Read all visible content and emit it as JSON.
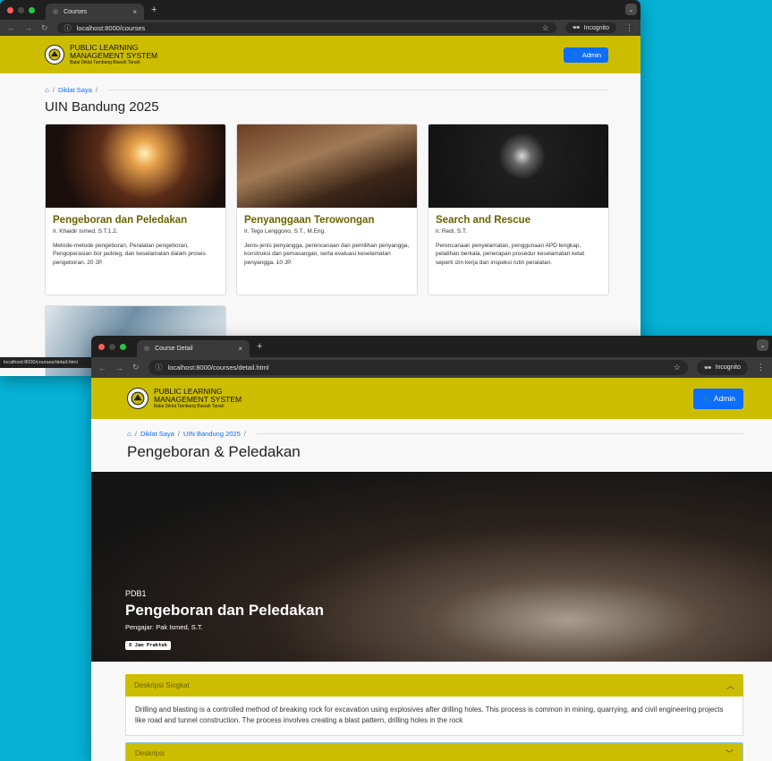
{
  "windows": {
    "courses": {
      "tab_title": "Courses",
      "url": "localhost:8000/courses",
      "incognito": "Incognito",
      "status_url": "localhost:8000/courses/detail.html"
    },
    "detail": {
      "tab_title": "Course Detail",
      "url": "localhost:8000/courses/detail.html",
      "incognito": "Incognito"
    }
  },
  "header": {
    "brand_line1": "PUBLIC LEARNING",
    "brand_line2": "MANAGEMENT SYSTEM",
    "brand_line3": "Balai Diklat Tambang Bawah Tanah",
    "admin_label": "Admin"
  },
  "courses_page": {
    "breadcrumb": [
      "Diklat Saya"
    ],
    "title": "UIN Bandung 2025",
    "cards": [
      {
        "title": "Pengeboran dan Peledakan",
        "teacher": "Ir. Khaidir Ismed, S.T.1.2.",
        "desc": "Metode-metode pengeboran, Peralatan pengeboran, Pengoperasian bor jackleg, dan keselamatan dalam proses pengeboran. 20 JP."
      },
      {
        "title": "Penyanggaan Terowongan",
        "teacher": "Ir. Tego Lenggono, S.T., M.Eng.",
        "desc": "Jenis-jenis penyangga, perencanaan dan pemilihan penyangga, konstruksi dan pemasangan, serta evaluasi keselamatan penyangga. 10 JP."
      },
      {
        "title": "Search and Rescue",
        "teacher": "ir. Redi, S.T.",
        "desc": "Perencanaan penyelamatan, penggunaan APD lengkap, pelatihan berkala, penerapan prosedur keselamatan ketat seperti izin kerja dan inspeksi rutin peralatan."
      }
    ]
  },
  "detail_page": {
    "breadcrumb": [
      "Diklat Saya",
      "UIN Bandung 2025"
    ],
    "title": "Pengeboran & Peledakan",
    "hero": {
      "code": "PDB1",
      "title": "Pengeboran dan Peledakan",
      "teacher": "Pengajar: Pak Ismed, S.T.",
      "badge": "8 Jam Praktek"
    },
    "accordion": {
      "section1_title": "Deskripsi Singkat",
      "section1_body": "Drilling and blasting is a controlled method of breaking rock for excavation using explosives after drilling holes. This process is common in mining, quarrying, and civil engineering projects like road and tunnel construction. The process involves creating a blast pattern, drilling holes in the rock",
      "section2_title": "Deskripsi"
    }
  },
  "colors": {
    "brand_yellow": "#cdbd00",
    "admin_blue": "#0d6efd",
    "desktop": "#05b2d6"
  }
}
